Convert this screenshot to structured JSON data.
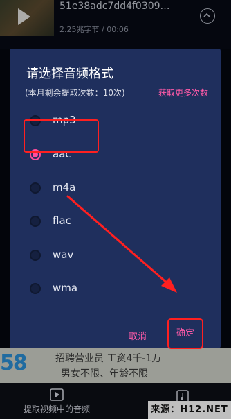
{
  "background": {
    "video_title": "51e38adc7dd4f0309…",
    "video_meta": "2.25兆字节 / 00:06",
    "ad": {
      "logo_text": "58",
      "line1": "招聘营业员    工资4千-1万",
      "line2": "男女不限、年龄不限"
    },
    "bottom_tab_label": "提取视频中的音频",
    "watermark": "来源：H12.NET"
  },
  "dialog": {
    "title": "请选择音频格式",
    "remaining": "(本月剩余提取次数：10次)",
    "more_link": "获取更多次数",
    "options": [
      {
        "label": "mp3",
        "checked": false
      },
      {
        "label": "aac",
        "checked": true
      },
      {
        "label": "m4a",
        "checked": false
      },
      {
        "label": "flac",
        "checked": false
      },
      {
        "label": "wav",
        "checked": false
      },
      {
        "label": "wma",
        "checked": false
      }
    ],
    "cancel_label": "取消",
    "ok_label": "确定"
  },
  "colors": {
    "dialog_bg": "#1f2f5d",
    "accent_pink": "#ff4d9e",
    "annotation_red": "#ff2020"
  }
}
